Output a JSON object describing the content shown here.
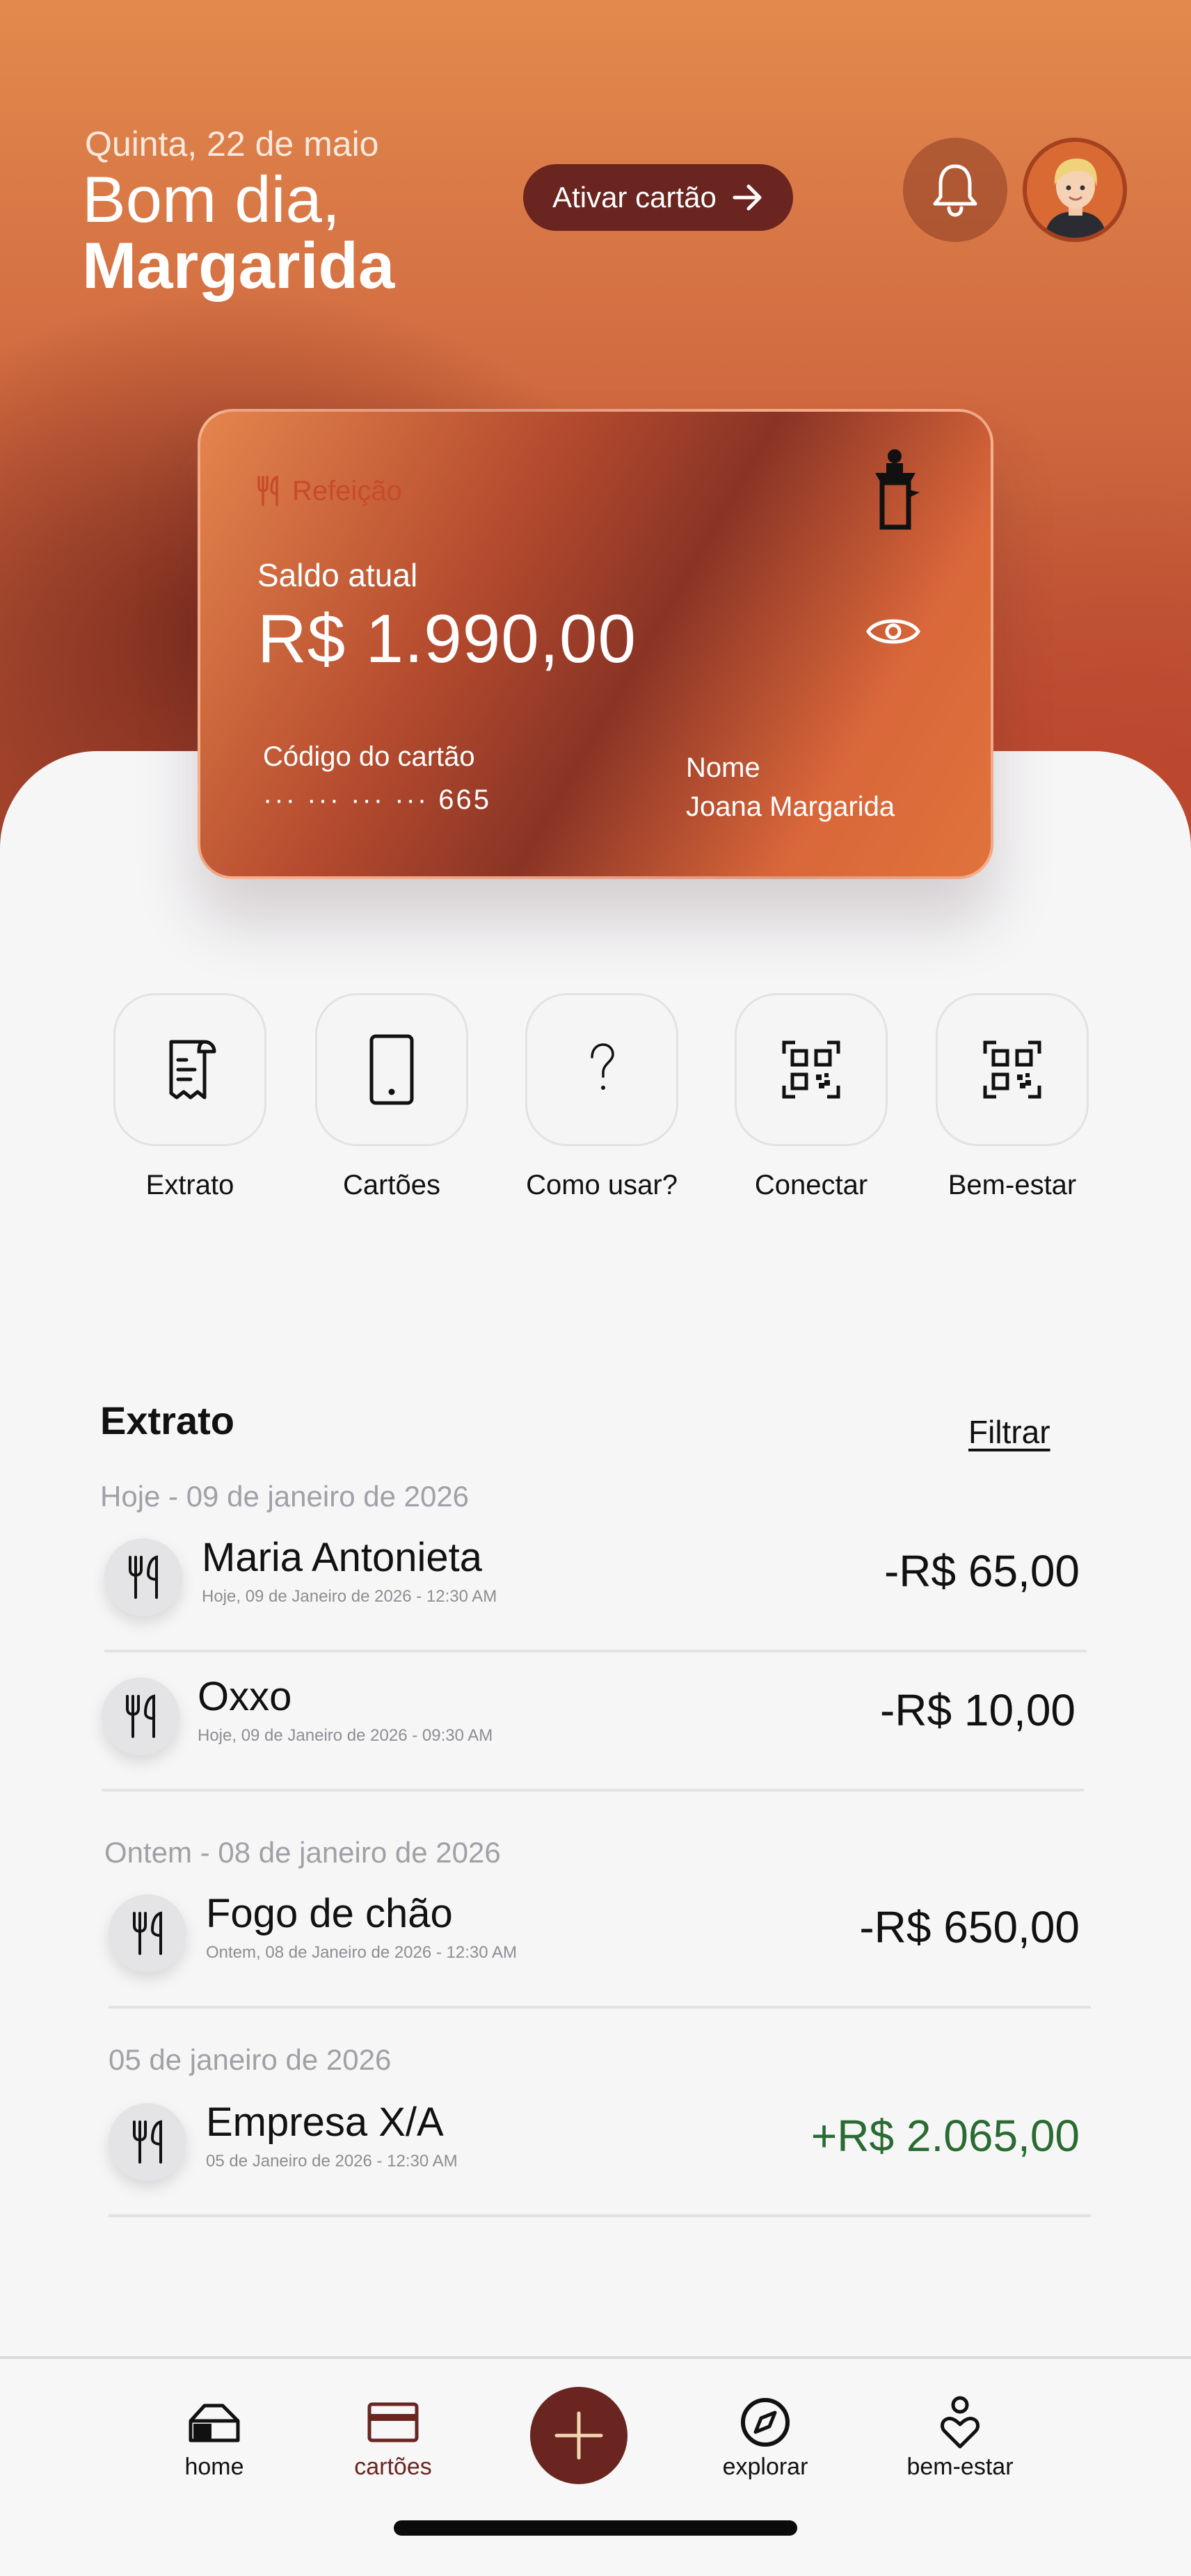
{
  "header": {
    "date": "Quinta, 22 de maio",
    "greeting": "Bom dia,",
    "user_name": "Margarida",
    "activate_label": "Ativar cartão",
    "icons": {
      "activate": "arrow-right-icon",
      "notifications": "bell-icon",
      "avatar": "user-avatar"
    }
  },
  "card": {
    "type": "Refeição",
    "type_icon": "fork-knife-icon",
    "logo_icon": "brand-figure-icon",
    "balance_label": "Saldo atual",
    "balance": "R$ 1.990,00",
    "visibility_icon": "eye-icon",
    "code_label": "Código do cartão",
    "code_value": "··· ··· ··· ··· 665",
    "holder_label": "Nome",
    "holder_name": "Joana Margarida"
  },
  "actions": [
    {
      "label": "Extrato",
      "icon": "receipt-icon"
    },
    {
      "label": "Cartões",
      "icon": "phone-icon"
    },
    {
      "label": "Como usar?",
      "icon": "question-icon"
    },
    {
      "label": "Conectar",
      "icon": "qr-code-icon"
    },
    {
      "label": "Bem-estar",
      "icon": "qr-code-icon"
    }
  ],
  "statement": {
    "title": "Extrato",
    "filter_label": "Filtrar",
    "groups": [
      {
        "label": "Hoje - 09 de janeiro de 2026",
        "items": [
          {
            "name": "Maria Antonieta",
            "date": "Hoje, 09 de Janeiro de 2026 - 12:30 AM",
            "amount": "-R$ 65,00",
            "type": "debit"
          },
          {
            "name": "Oxxo",
            "date": "Hoje, 09 de Janeiro de 2026 - 09:30 AM",
            "amount": "-R$ 10,00",
            "type": "debit"
          }
        ]
      },
      {
        "label": "Ontem - 08 de janeiro de 2026",
        "items": [
          {
            "name": "Fogo de chão",
            "date": "Ontem, 08 de Janeiro de 2026 - 12:30 AM",
            "amount": "-R$ 650,00",
            "type": "debit"
          }
        ]
      },
      {
        "label": "05 de janeiro de 2026",
        "items": [
          {
            "name": "Empresa X/A",
            "date": "05 de Janeiro de 2026 - 12:30 AM",
            "amount": "+R$ 2.065,00",
            "type": "credit"
          }
        ]
      }
    ]
  },
  "tabbar": {
    "items": [
      {
        "label": "home",
        "icon": "home-icon",
        "active": false
      },
      {
        "label": "cartões",
        "icon": "card-icon",
        "active": true
      },
      {
        "label": "explorar",
        "icon": "compass-icon",
        "active": false
      },
      {
        "label": "bem-estar",
        "icon": "wellbeing-icon",
        "active": false
      }
    ],
    "fab_icon": "plus-icon"
  },
  "colors": {
    "brand_dark": "#6b2520",
    "hero_orange": "#e28a4e",
    "credit_green": "#2a6b32",
    "muted": "#a0a0a6"
  }
}
